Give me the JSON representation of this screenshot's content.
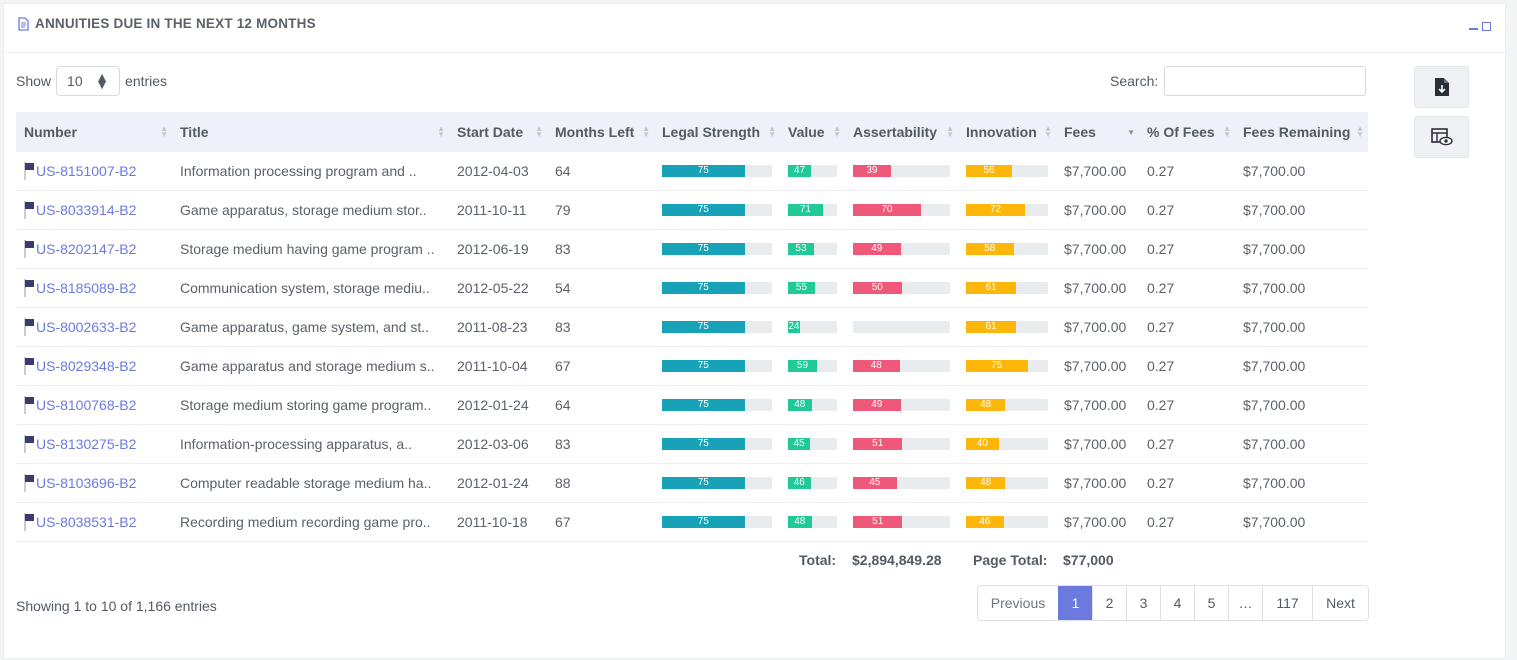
{
  "panel": {
    "title": "ANNUITIES DUE IN THE NEXT 12 MONTHS"
  },
  "length": {
    "show_label": "Show",
    "value": "10",
    "entries_label": "entries"
  },
  "search": {
    "label": "Search:",
    "value": "",
    "placeholder": ""
  },
  "columns": [
    "Number",
    "Title",
    "Start Date",
    "Months Left",
    "Legal Strength",
    "Value",
    "Assertability",
    "Innovation",
    "Fees",
    "% Of Fees",
    "Fees Remaining"
  ],
  "rows": [
    {
      "number": "US-8151007-B2",
      "title": "Information processing program and ..",
      "start": "2012-04-03",
      "months": "64",
      "legal": 75,
      "value": 47,
      "assert": 39,
      "innov": 56,
      "fees": "$7,700.00",
      "pct": "0.27",
      "remaining": "$7,700.00"
    },
    {
      "number": "US-8033914-B2",
      "title": "Game apparatus, storage medium stor..",
      "start": "2011-10-11",
      "months": "79",
      "legal": 75,
      "value": 71,
      "assert": 70,
      "innov": 72,
      "fees": "$7,700.00",
      "pct": "0.27",
      "remaining": "$7,700.00"
    },
    {
      "number": "US-8202147-B2",
      "title": "Storage medium having game program ..",
      "start": "2012-06-19",
      "months": "83",
      "legal": 75,
      "value": 53,
      "assert": 49,
      "innov": 58,
      "fees": "$7,700.00",
      "pct": "0.27",
      "remaining": "$7,700.00"
    },
    {
      "number": "US-8185089-B2",
      "title": "Communication system, storage mediu..",
      "start": "2012-05-22",
      "months": "54",
      "legal": 75,
      "value": 55,
      "assert": 50,
      "innov": 61,
      "fees": "$7,700.00",
      "pct": "0.27",
      "remaining": "$7,700.00"
    },
    {
      "number": "US-8002633-B2",
      "title": "Game apparatus, game system, and st..",
      "start": "2011-08-23",
      "months": "83",
      "legal": 75,
      "value": 24,
      "assert": 0,
      "innov": 61,
      "fees": "$7,700.00",
      "pct": "0.27",
      "remaining": "$7,700.00"
    },
    {
      "number": "US-8029348-B2",
      "title": "Game apparatus and storage medium s..",
      "start": "2011-10-04",
      "months": "67",
      "legal": 75,
      "value": 59,
      "assert": 48,
      "innov": 75,
      "fees": "$7,700.00",
      "pct": "0.27",
      "remaining": "$7,700.00"
    },
    {
      "number": "US-8100768-B2",
      "title": "Storage medium storing game program..",
      "start": "2012-01-24",
      "months": "64",
      "legal": 75,
      "value": 48,
      "assert": 49,
      "innov": 48,
      "fees": "$7,700.00",
      "pct": "0.27",
      "remaining": "$7,700.00"
    },
    {
      "number": "US-8130275-B2",
      "title": "Information-processing apparatus, a..",
      "start": "2012-03-06",
      "months": "83",
      "legal": 75,
      "value": 45,
      "assert": 51,
      "innov": 40,
      "fees": "$7,700.00",
      "pct": "0.27",
      "remaining": "$7,700.00"
    },
    {
      "number": "US-8103696-B2",
      "title": "Computer readable storage medium ha..",
      "start": "2012-01-24",
      "months": "88",
      "legal": 75,
      "value": 46,
      "assert": 45,
      "innov": 48,
      "fees": "$7,700.00",
      "pct": "0.27",
      "remaining": "$7,700.00"
    },
    {
      "number": "US-8038531-B2",
      "title": "Recording medium recording game pro..",
      "start": "2011-10-18",
      "months": "67",
      "legal": 75,
      "value": 48,
      "assert": 51,
      "innov": 46,
      "fees": "$7,700.00",
      "pct": "0.27",
      "remaining": "$7,700.00"
    }
  ],
  "totals": {
    "total_label": "Total:",
    "total_value": "$2,894,849.28",
    "page_total_label": "Page Total:",
    "page_total_value": "$77,000"
  },
  "info": "Showing 1 to 10 of 1,166 entries",
  "pagination": [
    "Previous",
    "1",
    "2",
    "3",
    "4",
    "5",
    "…",
    "117",
    "Next"
  ],
  "pagination_active": "1",
  "icons": {
    "title": "file-text-icon",
    "export": "file-download-icon",
    "columns": "table-eye-icon",
    "row_flag": "us-flag-icon"
  },
  "colors": {
    "accent": "#6c7ae0",
    "legal": "#17a2b8",
    "value": "#20c997",
    "assertability": "#f0587a",
    "innovation": "#fdb60a"
  }
}
